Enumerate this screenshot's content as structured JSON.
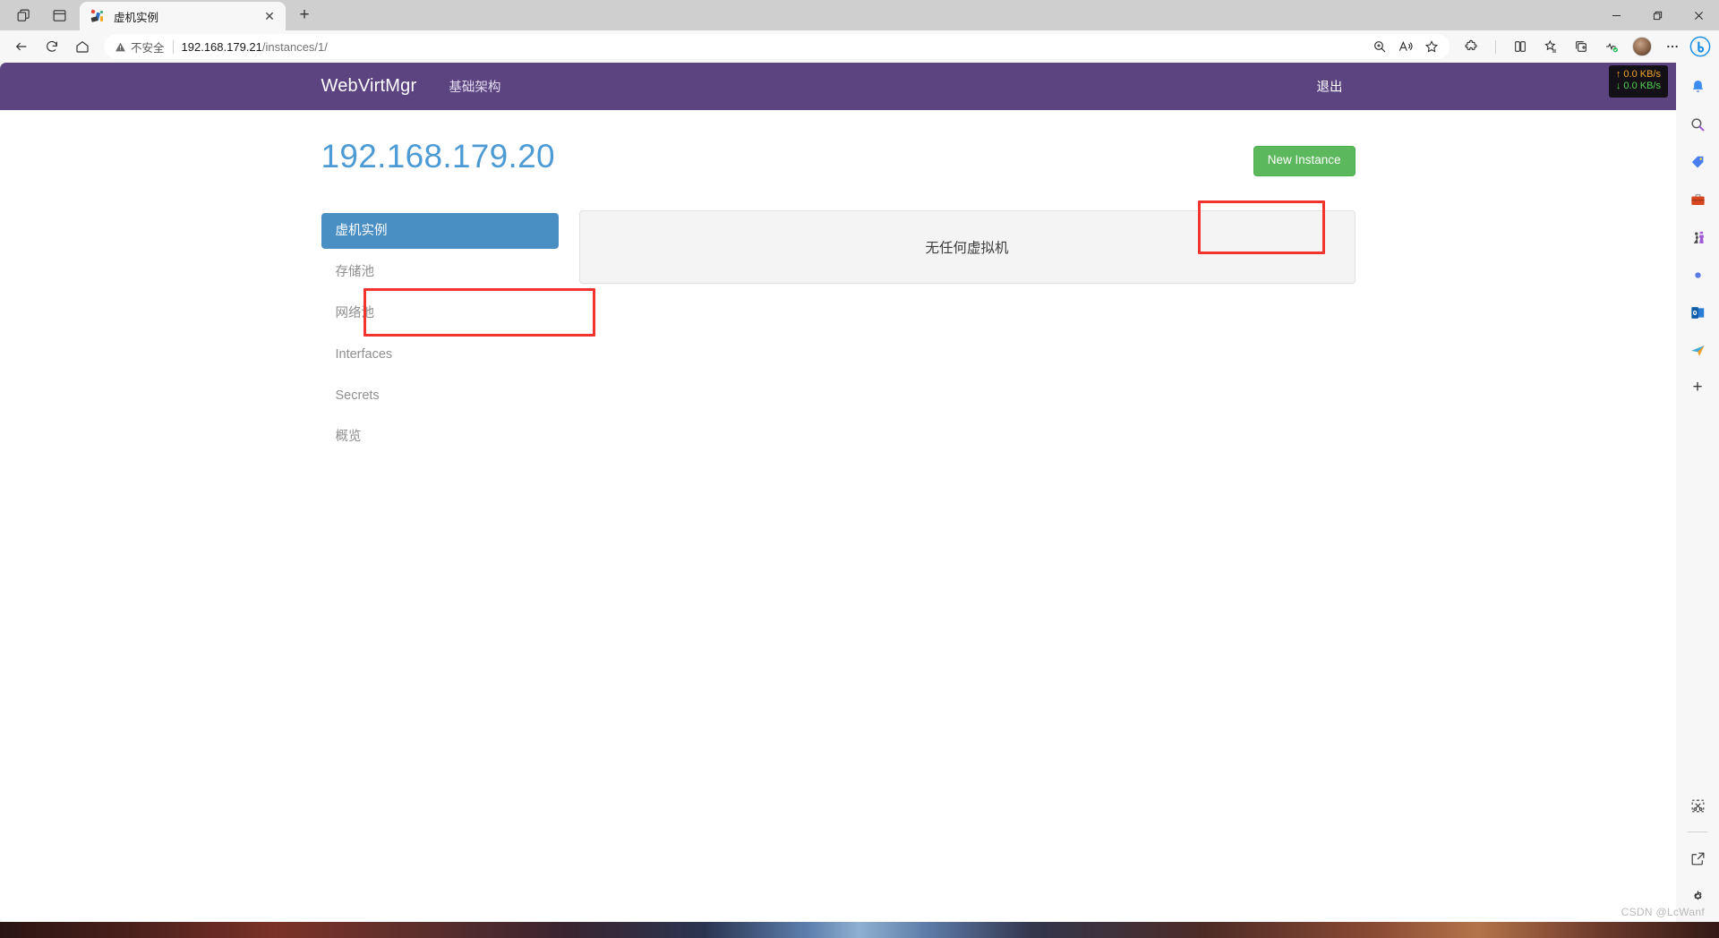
{
  "browser": {
    "tab": {
      "title": "虚机实例",
      "favicon": "webvirtmgr-favicon",
      "close_label": "✕"
    },
    "new_tab_label": "+",
    "window_controls": {
      "minimize": "minimize-icon",
      "restore": "restore-icon",
      "close": "close-icon"
    },
    "toolbar": {
      "back": "back-arrow-icon",
      "refresh": "refresh-icon",
      "home": "home-icon",
      "security_warning": "不安全",
      "url_host": "192.168.179.21",
      "url_path": "/instances/1/",
      "zoom_icon": "zoom-in-icon",
      "read_aloud_icon": "read-aloud-icon",
      "favorite_icon": "star-icon",
      "extensions_icon": "extensions-puzzle-icon",
      "split_screen_icon": "split-screen-icon",
      "collections_icon": "collections-icon",
      "add_tab_to_group_icon": "add-tab-icon",
      "browser_essentials_icon": "browser-essentials-icon",
      "profile_icon": "avatar",
      "settings_more_icon": "ellipsis-icon",
      "copilot_icon": "copilot-bing-icon"
    },
    "sidebar_icons": [
      "notifications-bell-icon",
      "search-icon",
      "shopping-tag-icon",
      "tools-briefcase-icon",
      "games-icon",
      "microsoft365-icon",
      "outlook-icon",
      "send-plane-icon"
    ],
    "sidebar_add_label": "+",
    "sidebar_bottom_icons": [
      "screenshot-snip-icon",
      "open-in-new-window-icon",
      "settings-gear-icon"
    ]
  },
  "netmon": {
    "upload": "↑ 0.0 KB/s",
    "download": "↓ 0.0 KB/s",
    "upload_color": "#f0a428",
    "download_color": "#4ed14e"
  },
  "navbar": {
    "brand": "WebVirtMgr",
    "links": [
      {
        "label": "基础架构"
      }
    ],
    "logout_label": "退出",
    "background_color": "#5b4480"
  },
  "page": {
    "title": "192.168.179.20",
    "title_color": "#4d9bd4",
    "new_instance_button": "New Instance",
    "new_instance_color": "#5cb85c"
  },
  "sidebar": {
    "items": [
      {
        "label": "虚机实例",
        "active": true
      },
      {
        "label": "存储池",
        "active": false
      },
      {
        "label": "网络池",
        "active": false
      },
      {
        "label": "Interfaces",
        "active": false
      },
      {
        "label": "Secrets",
        "active": false
      },
      {
        "label": "概览",
        "active": false
      }
    ],
    "active_color": "#4a8fc4"
  },
  "content": {
    "empty_message": "无任何虚拟机"
  },
  "annotations": {
    "color": "#f2332e",
    "boxes": [
      {
        "target": "new-instance-button"
      },
      {
        "target": "sidebar-item-instances"
      }
    ]
  },
  "watermark": "CSDN @LcWanf"
}
